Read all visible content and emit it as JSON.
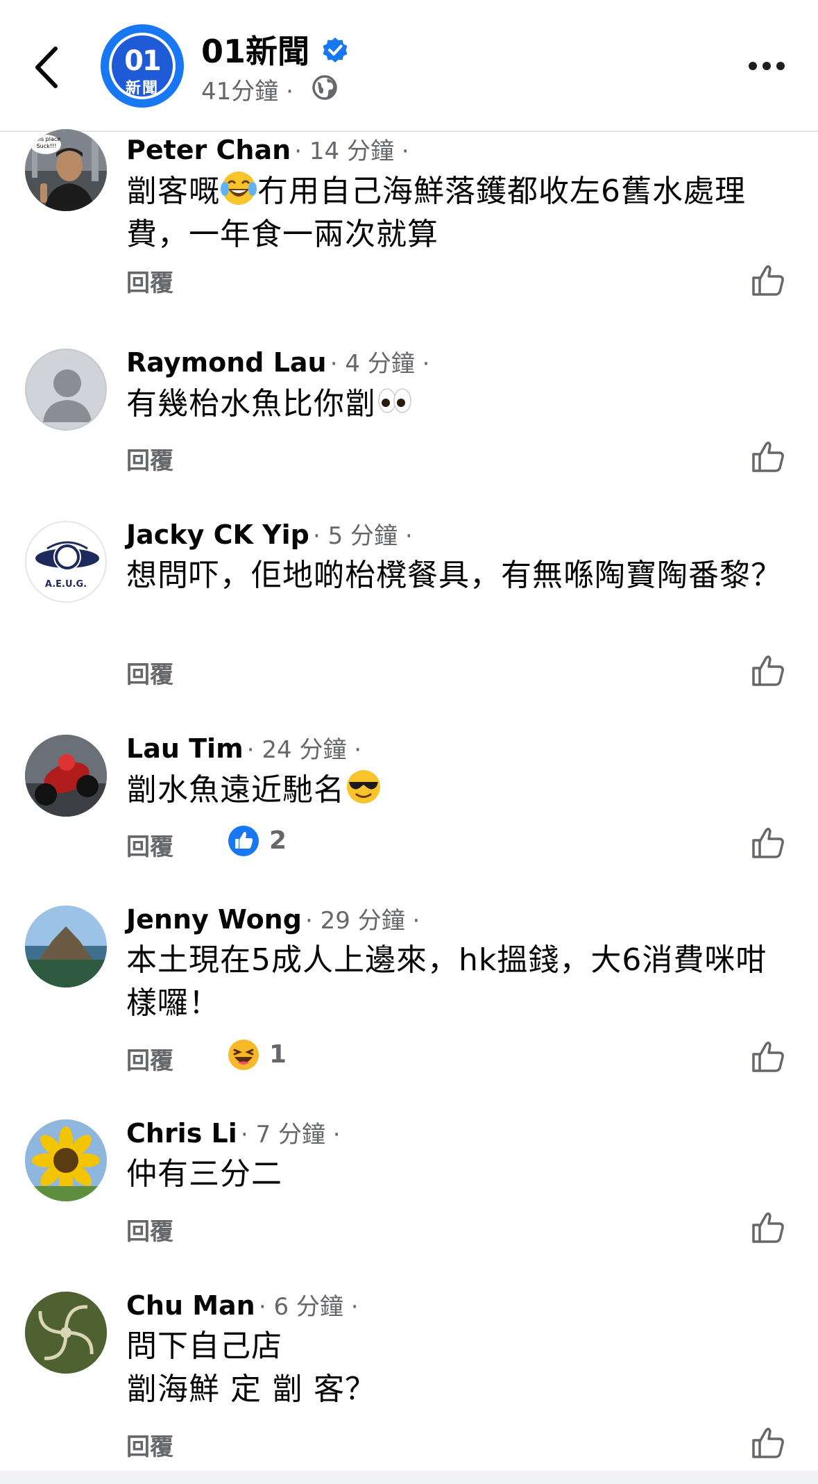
{
  "header": {
    "page_name": "01新聞",
    "logo_number": "01",
    "logo_text": "新聞",
    "time": "41分鐘",
    "separator": "·"
  },
  "reply_label": "回覆",
  "comments": [
    {
      "author": "Peter Chan",
      "time": "· 14 分鐘 ·",
      "avatar_text": "This place Suck!!!",
      "text_before": "劏客嘅",
      "emoji": "joy",
      "text_after": "冇用自己海鮮落鑊都收左6舊水處理費，一年食一兩次就算"
    },
    {
      "author": "Raymond Lau",
      "time": "· 4 分鐘 ·",
      "text_before": "有幾枱水魚比你劏",
      "emoji": "eyes",
      "text_after": ""
    },
    {
      "author": "Jacky CK Yip",
      "time": "· 5 分鐘 ·",
      "avatar_text": "A.E.U.G.",
      "text_before": "想問吓，佢地啲枱櫈餐具，有無喺陶寶陶番黎？",
      "emoji": "",
      "text_after": ""
    },
    {
      "author": "Lau Tim",
      "time": "· 24 分鐘 ·",
      "text_before": "劏水魚遠近馳名",
      "emoji": "sunglasses",
      "text_after": "",
      "reaction": {
        "type": "like",
        "count": "2"
      }
    },
    {
      "author": "Jenny Wong",
      "time": "· 29 分鐘 ·",
      "text_before": "本土現在5成人上邊來，hk搵錢，大6消費咪咁樣囉！",
      "emoji": "",
      "text_after": "",
      "reaction": {
        "type": "haha",
        "count": "1"
      }
    },
    {
      "author": "Chris Li",
      "time": "· 7 分鐘 ·",
      "text_before": "仲有三分二",
      "emoji": "",
      "text_after": ""
    },
    {
      "author": "Chu Man",
      "time": "· 6 分鐘 ·",
      "text_before": "問下自己店",
      "emoji": "",
      "text_after": "",
      "line2": "劏海鮮 定 劏 客？"
    }
  ],
  "colors": {
    "accent": "#1877f2",
    "secondary_text": "#65676b",
    "primary_text": "#050505"
  }
}
